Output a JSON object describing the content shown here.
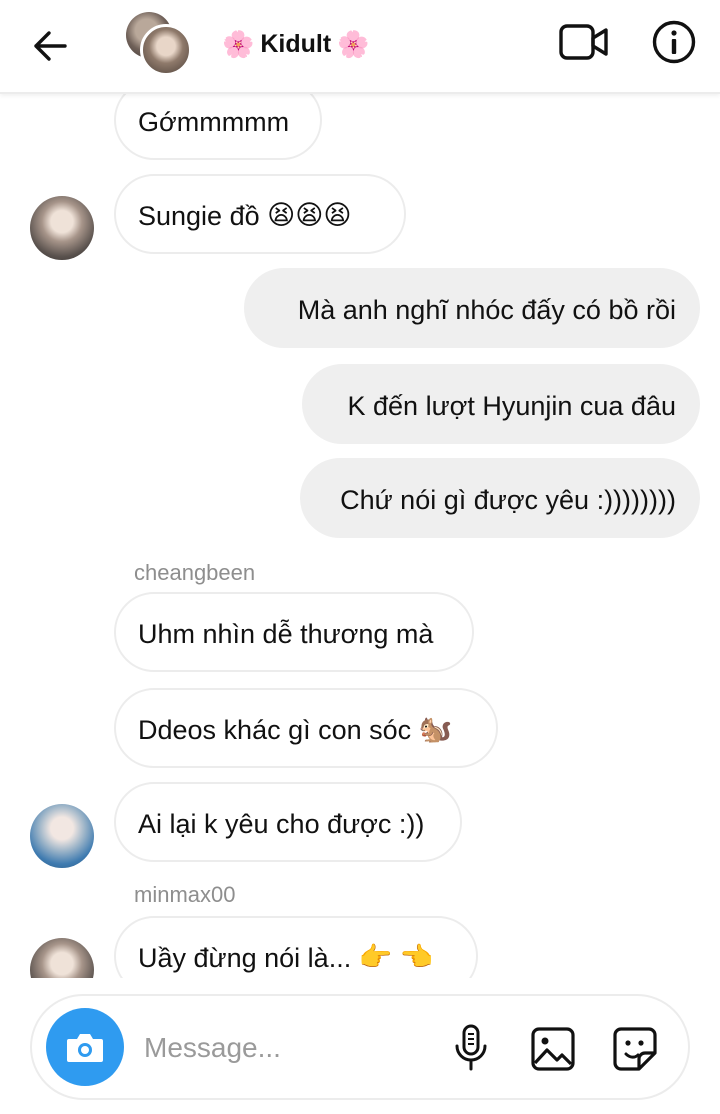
{
  "header": {
    "title": "Kidult",
    "title_decoration": "🌸",
    "icons": {
      "back": "arrow-left-icon",
      "video": "video-camera-icon",
      "info": "info-icon"
    }
  },
  "messages": [
    {
      "direction": "in",
      "text": "Gớmmmmm"
    },
    {
      "direction": "in",
      "text": "Sungie đồ",
      "emoji": "😫😫😫"
    },
    {
      "direction": "out",
      "text": "Mà anh nghĩ nhóc đấy có bồ rồi"
    },
    {
      "direction": "out",
      "text": "K đến lượt Hyunjin cua đâu"
    },
    {
      "direction": "out",
      "text": "Chứ nói gì được yêu :))))))))"
    },
    {
      "direction": "in",
      "sender": "cheangbeen",
      "text": "Uhm nhìn dễ thương mà"
    },
    {
      "direction": "in",
      "text": "Ddeos khác gì con sóc",
      "emoji": "🐿️"
    },
    {
      "direction": "in",
      "text": "Ai lại k yêu cho được :))"
    },
    {
      "direction": "in",
      "sender": "minmax00",
      "text": "Uầy đừng nói là...",
      "emoji": "👉 👈"
    }
  ],
  "composer": {
    "placeholder": "Message...",
    "icons": {
      "camera": "camera-icon",
      "mic": "microphone-icon",
      "gallery": "image-icon",
      "sticker": "sticker-icon"
    },
    "camera_color": "#2f9bf0"
  }
}
